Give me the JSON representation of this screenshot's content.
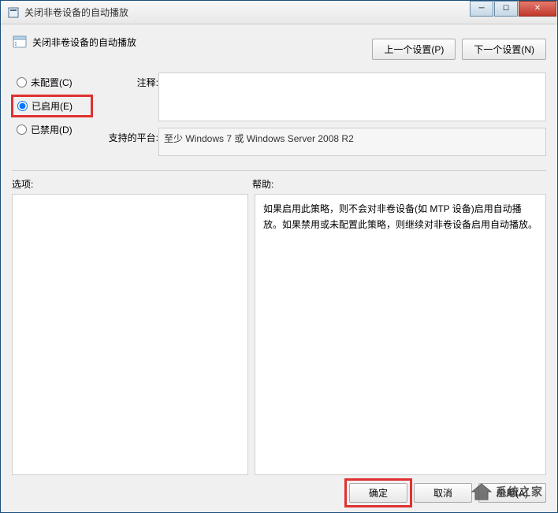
{
  "window": {
    "title": "关闭非卷设备的自动播放"
  },
  "policy": {
    "title": "关闭非卷设备的自动播放"
  },
  "nav": {
    "prev": "上一个设置(P)",
    "next": "下一个设置(N)"
  },
  "radios": {
    "not_configured": "未配置(C)",
    "enabled": "已启用(E)",
    "disabled": "已禁用(D)",
    "selected": "enabled"
  },
  "details": {
    "comment_label": "注释:",
    "comment_value": "",
    "platform_label": "支持的平台:",
    "platform_value": "至少 Windows 7 或 Windows Server 2008 R2"
  },
  "panels": {
    "options_label": "选项:",
    "help_label": "帮助:",
    "help_text": "如果启用此策略，则不会对非卷设备(如 MTP 设备)启用自动播放。如果禁用或未配置此策略，则继续对非卷设备启用自动播放。"
  },
  "footer": {
    "ok": "确定",
    "cancel": "取消",
    "apply": "应用(A)"
  },
  "watermark": {
    "text": "系统之家"
  }
}
